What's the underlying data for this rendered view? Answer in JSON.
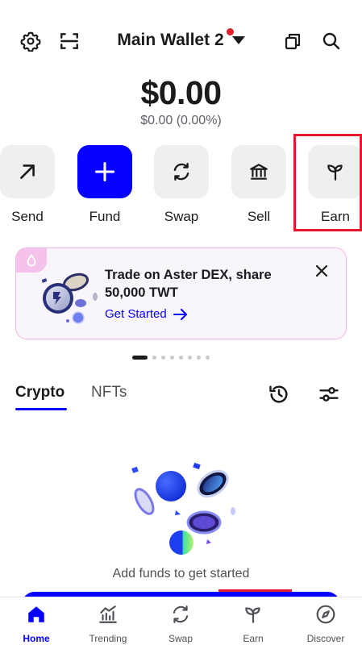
{
  "header": {
    "wallet_name": "Main Wallet 2",
    "icons": [
      "settings-gear-icon",
      "scan-qr-icon",
      "copy-icon",
      "search-icon"
    ],
    "notification_color": "#e0202a"
  },
  "balance": {
    "amount": "$0.00",
    "change": "$0.00 (0.00%)"
  },
  "actions": [
    {
      "label": "Send",
      "icon": "arrow-up-right-icon"
    },
    {
      "label": "Fund",
      "icon": "plus-icon"
    },
    {
      "label": "Swap",
      "icon": "swap-arrows-icon"
    },
    {
      "label": "Sell",
      "icon": "bank-icon"
    },
    {
      "label": "Earn",
      "icon": "sprout-icon"
    }
  ],
  "promo": {
    "title": "Trade on Aster DEX, share 50,000 TWT",
    "cta": "Get Started"
  },
  "carousel": {
    "total": 8,
    "active_index": 0
  },
  "tabs": [
    {
      "label": "Crypto",
      "active": true
    },
    {
      "label": "NFTs",
      "active": false
    }
  ],
  "empty_state": {
    "message": "Add funds to get started"
  },
  "bottom_nav": [
    {
      "label": "Home",
      "icon": "home-icon",
      "active": true
    },
    {
      "label": "Trending",
      "icon": "trending-chart-icon",
      "active": false
    },
    {
      "label": "Swap",
      "icon": "swap-icon",
      "active": false
    },
    {
      "label": "Earn",
      "icon": "sprout-icon",
      "active": false
    },
    {
      "label": "Discover",
      "icon": "compass-icon",
      "active": false
    }
  ],
  "colors": {
    "accent": "#0500ff",
    "highlight_box": "#e3172d",
    "tile_bg": "#efefef",
    "promo_border": "#f3b6ea"
  }
}
